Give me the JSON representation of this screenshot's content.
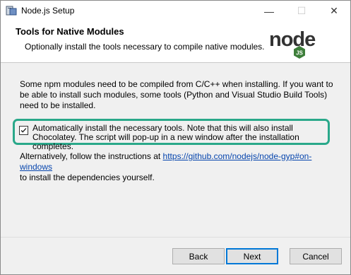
{
  "window": {
    "title": "Node.js Setup",
    "controls": {
      "minimize": "—",
      "maximize": "☐",
      "close": "✕"
    }
  },
  "header": {
    "title": "Tools for Native Modules",
    "subtitle": "Optionally install the tools necessary to compile native modules.",
    "logo_text": "node",
    "logo_badge": "JS",
    "logo_color": "#3d7e3a"
  },
  "body": {
    "intro": "Some npm modules need to be compiled from C/C++ when installing. If you want to be able to install such modules, some tools (Python and Visual Studio Build Tools) need to be installed.",
    "checkbox": {
      "checked": true,
      "label": "Automatically install the necessary tools. Note that this will also install Chocolatey. The script will pop-up in a new window after the installation completes."
    },
    "alt_prefix": "Alternatively, follow the instructions at ",
    "alt_link": "https://github.com/nodejs/node-gyp#on-windows",
    "alt_suffix": "to install the dependencies yourself."
  },
  "buttons": {
    "back": "Back",
    "next": "Next",
    "cancel": "Cancel"
  },
  "colors": {
    "highlight": "#2aa88a",
    "link": "#0645ad"
  }
}
